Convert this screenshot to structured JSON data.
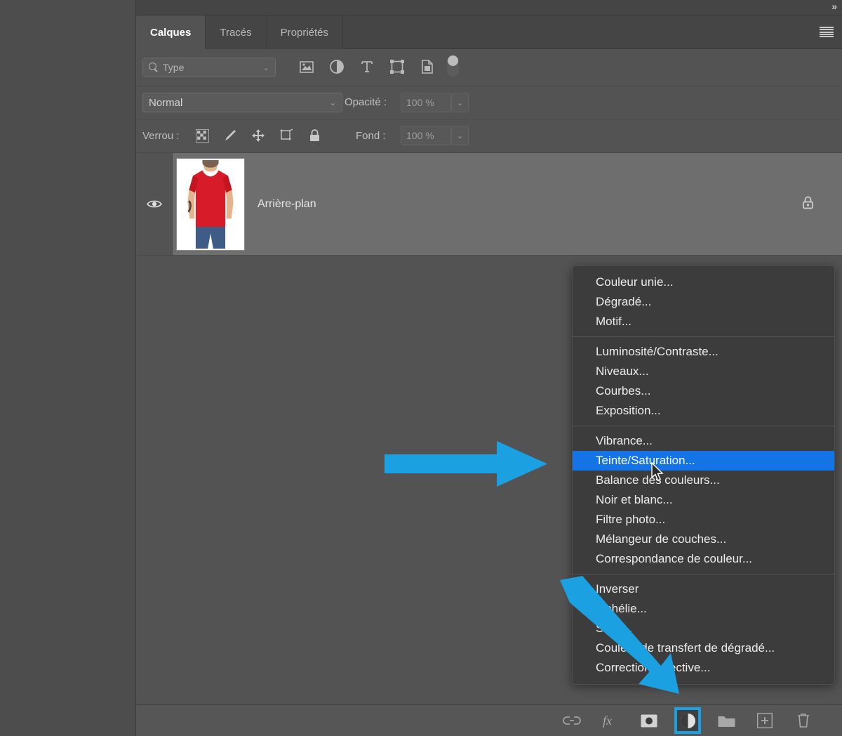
{
  "colors": {
    "panel_bg": "#535353",
    "header_bg": "#454545",
    "layer_selected": "#6e6e6e",
    "menu_bg": "#3c3c3c",
    "menu_highlight": "#1473e6",
    "arrow_blue": "#1ba1e2",
    "highlight_outline": "#1ba1e2"
  },
  "panel": {
    "expand_chevron": "»",
    "menu_icon": "hamburger-icon",
    "tabs": [
      {
        "label": "Calques",
        "active": true
      },
      {
        "label": "Tracés",
        "active": false
      },
      {
        "label": "Propriétés",
        "active": false
      }
    ]
  },
  "filter_row": {
    "search_icon": "search-icon",
    "filter_type_label": "Type",
    "dropdown_caret": "⌄",
    "icons": [
      {
        "name": "pixel-layer-filter-icon"
      },
      {
        "name": "adjustment-layer-filter-icon"
      },
      {
        "name": "type-layer-filter-icon"
      },
      {
        "name": "shape-layer-filter-icon"
      },
      {
        "name": "smart-object-filter-icon"
      }
    ],
    "toggle": {
      "name": "filter-enable-toggle",
      "state": "on"
    }
  },
  "blend_row": {
    "blend_mode": "Normal",
    "opacity_label": "Opacité :",
    "opacity_value": "100 %",
    "caret": "⌄"
  },
  "lock_row": {
    "lock_label": "Verrou :",
    "lock_icons": [
      {
        "name": "lock-transparent-pixels-icon"
      },
      {
        "name": "lock-image-pixels-icon"
      },
      {
        "name": "lock-position-icon"
      },
      {
        "name": "lock-artboard-nesting-icon"
      },
      {
        "name": "lock-all-icon"
      }
    ],
    "fill_label": "Fond :",
    "fill_value": "100 %",
    "caret": "⌄"
  },
  "layers": [
    {
      "name": "Arrière-plan",
      "visible": true,
      "locked": true,
      "selected": true,
      "thumbnail": "red-tshirt-model-thumbnail"
    }
  ],
  "bottom_toolbar": [
    {
      "name": "link-layers-icon",
      "glyph": "link",
      "highlighted": false
    },
    {
      "name": "layer-style-fx-icon",
      "glyph": "fx",
      "highlighted": false
    },
    {
      "name": "add-layer-mask-icon",
      "glyph": "mask",
      "highlighted": false
    },
    {
      "name": "new-adjustment-layer-icon",
      "glyph": "adjustment",
      "highlighted": true
    },
    {
      "name": "new-group-icon",
      "glyph": "folder",
      "highlighted": false
    },
    {
      "name": "new-layer-icon",
      "glyph": "new-layer",
      "highlighted": false
    },
    {
      "name": "delete-layer-icon",
      "glyph": "trash",
      "highlighted": false
    }
  ],
  "context_menu": {
    "groups": [
      {
        "items": [
          {
            "label": "Couleur unie...",
            "selected": false
          },
          {
            "label": "Dégradé...",
            "selected": false
          },
          {
            "label": "Motif...",
            "selected": false
          }
        ]
      },
      {
        "items": [
          {
            "label": "Luminosité/Contraste...",
            "selected": false
          },
          {
            "label": "Niveaux...",
            "selected": false
          },
          {
            "label": "Courbes...",
            "selected": false
          },
          {
            "label": "Exposition...",
            "selected": false
          }
        ]
      },
      {
        "items": [
          {
            "label": "Vibrance...",
            "selected": false
          },
          {
            "label": "Teinte/Saturation...",
            "selected": true
          },
          {
            "label": "Balance des couleurs...",
            "selected": false
          },
          {
            "label": "Noir et blanc...",
            "selected": false
          },
          {
            "label": "Filtre photo...",
            "selected": false
          },
          {
            "label": "Mélangeur de couches...",
            "selected": false
          },
          {
            "label": "Correspondance de couleur...",
            "selected": false
          }
        ]
      },
      {
        "items": [
          {
            "label": "Inverser",
            "selected": false
          },
          {
            "label": "Isohélie...",
            "selected": false
          },
          {
            "label": "Seuil...",
            "selected": false
          },
          {
            "label": "Couleur de transfert de dégradé...",
            "selected": false
          },
          {
            "label": "Correction sélective...",
            "selected": false
          }
        ]
      }
    ]
  },
  "annotations": [
    {
      "name": "horizontal-pointer-arrow",
      "direction": "right"
    },
    {
      "name": "diagonal-pointer-arrow",
      "direction": "down-right"
    }
  ]
}
